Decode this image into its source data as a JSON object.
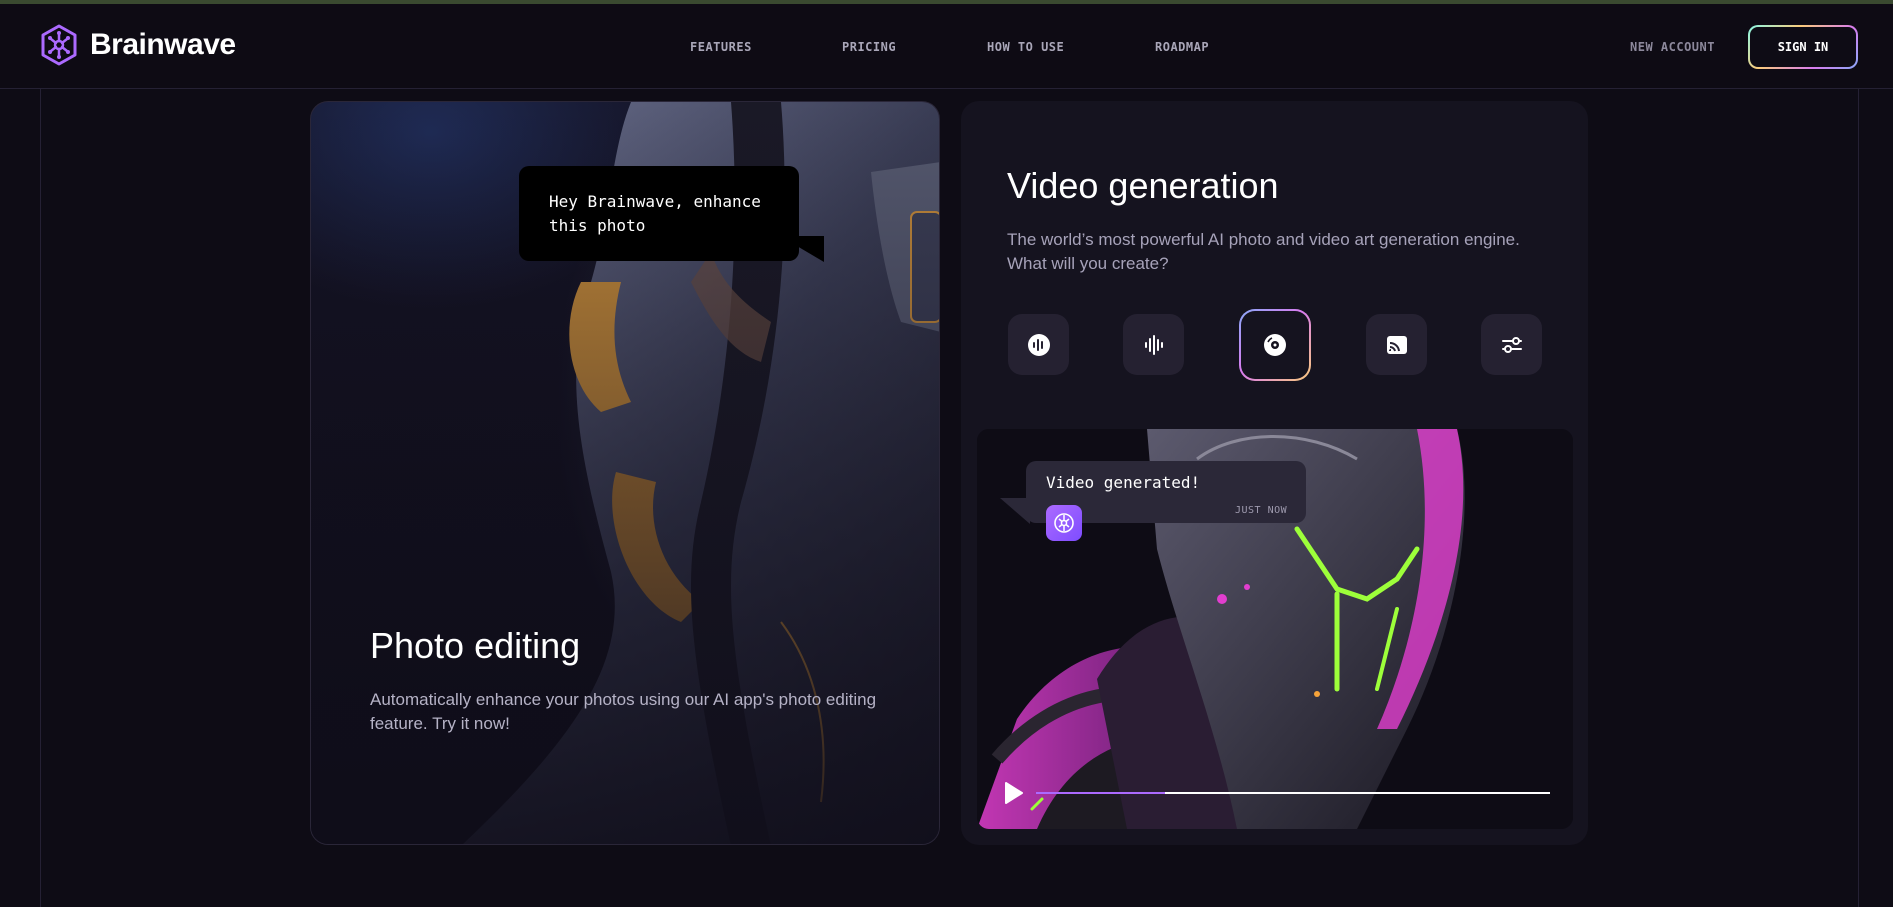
{
  "brand": {
    "name": "Brainwave"
  },
  "nav": {
    "items": [
      "FEATURES",
      "PRICING",
      "HOW TO USE",
      "ROADMAP"
    ],
    "new_account": "NEW ACCOUNT",
    "sign_in": "SIGN IN"
  },
  "photo_card": {
    "bubble_text": "Hey Brainwave, enhance this photo",
    "title": "Photo editing",
    "description": "Automatically enhance your photos using our AI app's photo editing feature. Try it now!"
  },
  "video_card": {
    "title": "Video generation",
    "description": "The world’s most powerful AI photo and video art generation engine. What will you create?",
    "tools": [
      {
        "icon": "recording-icon",
        "active": false
      },
      {
        "icon": "audio-wave-icon",
        "active": false
      },
      {
        "icon": "disc-icon",
        "active": true
      },
      {
        "icon": "image-cast-icon",
        "active": false
      },
      {
        "icon": "sliders-icon",
        "active": false
      }
    ],
    "chat": {
      "message": "Video generated!",
      "time": "JUST NOW"
    },
    "player": {
      "progress": 0.25
    }
  },
  "colors": {
    "background": "#0e0c15",
    "accent_purple": "#ac6aff",
    "neon_green": "#9dff3a",
    "neon_pink": "#e23ecf"
  }
}
